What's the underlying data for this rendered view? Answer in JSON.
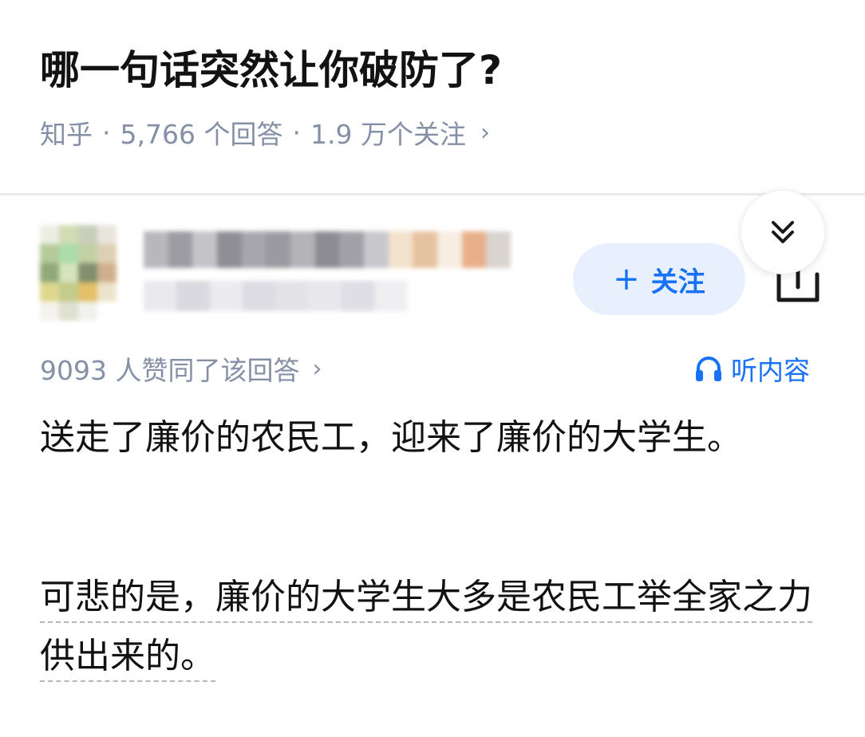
{
  "question": {
    "title": "哪一句话突然让你破防了?",
    "source": "知乎",
    "answers_count": "5,766 个回答",
    "followers_count": "1.9 万个关注",
    "separator": "·",
    "chevron": "›"
  },
  "author": {
    "follow_plus": "+",
    "follow_label": "关注",
    "avatar_colors": [
      "#e9ecde",
      "#c9d6a6",
      "#bfc6b0",
      "#e6e1d8",
      "#a8c18a",
      "#9ed69a",
      "#b8c994",
      "#d8c7a8",
      "#7f9a62",
      "#cfe0b0",
      "#6d7c55",
      "#c7a37a",
      "#d9d27c",
      "#b9c37a",
      "#e0b64e",
      "#eadfc4",
      "#f3f1ea",
      "#d9dbc8",
      "#eef0ea",
      "#ffffff"
    ],
    "name_blur_colors": [
      "#b8b8bc",
      "#9c9ca2",
      "#c4c4c8",
      "#8e8e94",
      "#a6a6ac",
      "#9a9aa0",
      "#b4b4b8",
      "#8c8c92",
      "#a0a0a6",
      "#c8c8cc",
      "#f2e1cc",
      "#e6c3a0",
      "#f7ede2",
      "#e8b08a",
      "#d9d4cf"
    ],
    "sub_blur_colors": [
      "#e4e4ea",
      "#d0d0d8",
      "#e8e8ec",
      "#d4d4dc",
      "#dcdce2",
      "#e2e2e8",
      "#d6d6de",
      "#eaeaee"
    ]
  },
  "answer": {
    "votes": "9093 人赞同了该回答",
    "chevron": "›",
    "listen_label": "听内容",
    "paragraph_1": "送走了廉价的农民工，迎来了廉价的大学生。",
    "paragraph_2": "可悲的是，廉价的大学生大多是农民工举全家之力供出来的。"
  },
  "colors": {
    "accent": "#1772f6",
    "accent_bg": "#e8f0fe",
    "meta_gray": "#8590a6"
  }
}
